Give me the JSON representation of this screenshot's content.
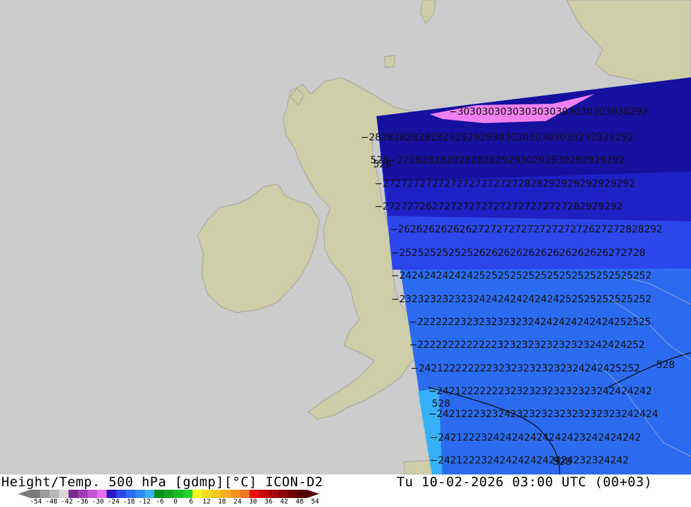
{
  "map": {
    "contour_labels": [
      {
        "text": "−3030303030303030303030303030292",
        "row": "r0"
      },
      {
        "text": "−2828282828282929292930303030303030292929292",
        "row": "r1"
      },
      {
        "text": "528−2728282828282828292930292930292929292",
        "row": "r2"
      },
      {
        "text": "−27272727272727272727272828292929292929292",
        "row": "r3"
      },
      {
        "text": "−272727262727272727272727272727282929292",
        "row": "r4"
      },
      {
        "text": "−2626262626262727272727272727272627272828292",
        "row": "r5"
      },
      {
        "text": "−2525252525252626262626262626262626272728",
        "row": "r6"
      },
      {
        "text": "−24242424242425252525252525252525252525252",
        "row": "r7"
      },
      {
        "text": "−23232323232324242424242424252525252525252",
        "row": "r8"
      },
      {
        "text": "−22222223232323232324242424242424252525",
        "row": "r9"
      },
      {
        "text": "−2222222222222323232323232323242424252",
        "row": "r10"
      },
      {
        "text": "−242122222222323232323232324242425252",
        "row": "r11"
      },
      {
        "text": "−24212222222323232323232323242424242",
        "row": "r12"
      },
      {
        "text": "−242122232324232323232323232323242424",
        "row": "r13"
      },
      {
        "text": "−242122232424242424242423242424242",
        "row": "r14"
      },
      {
        "text": "−2421222324242424242424232324242",
        "row": "r15"
      }
    ],
    "isoline_labels": [
      "528",
      "528",
      "528",
      "528"
    ]
  },
  "footer": {
    "title_left": "Height/Temp. 500 hPa [gdmp][°C] ICON-D2",
    "title_right": "Tu 10-02-2026 03:00 UTC (00+03)",
    "colorbar_ticks": [
      "-54",
      "-48",
      "-42",
      "-36",
      "-30",
      "-24",
      "-18",
      "-12",
      "-6",
      "0",
      "6",
      "12",
      "18",
      "24",
      "30",
      "36",
      "42",
      "48",
      "54"
    ],
    "colorbar_colors": [
      "#7a7a7a",
      "#9a9a9a",
      "#b8b8b8",
      "#d6d6d6",
      "#7b2a8e",
      "#a13db4",
      "#c653d6",
      "#e56fef",
      "#2a14c8",
      "#2b46ea",
      "#2b6cf2",
      "#2f8ef5",
      "#36b1f7",
      "#0b8c1c",
      "#0fa321",
      "#16bb27",
      "#21d22e",
      "#f5f51f",
      "#f4dc21",
      "#f5c623",
      "#f5ae22",
      "#f59421",
      "#f57622",
      "#e80d0d",
      "#c70a0a",
      "#a80808",
      "#8c0505",
      "#6e0303",
      "#520000"
    ]
  }
}
